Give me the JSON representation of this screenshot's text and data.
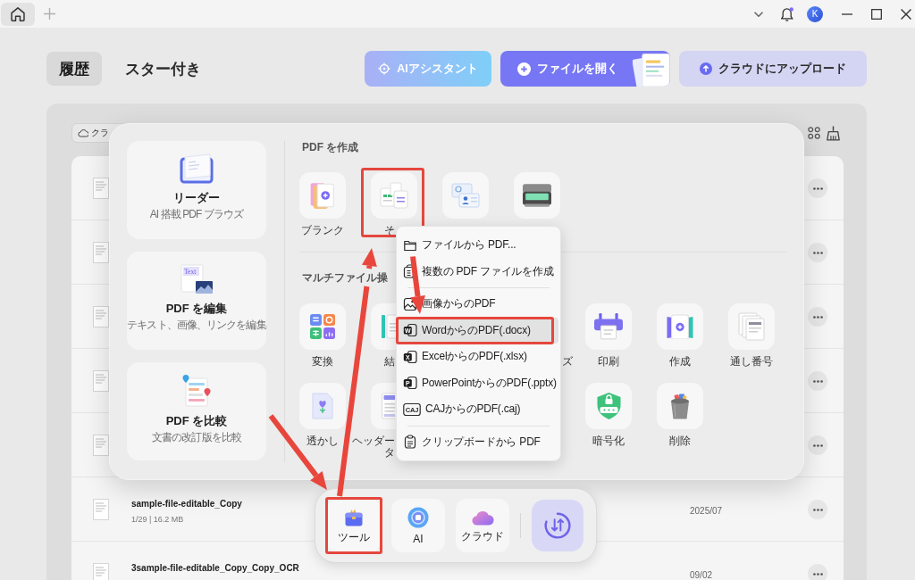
{
  "titlebar": {
    "avatar": "K"
  },
  "header": {
    "tabs": [
      {
        "label": "履歴",
        "selected": true
      },
      {
        "label": "スター付き",
        "selected": false
      }
    ],
    "actions": [
      {
        "kind": "ai",
        "label": "AIアシスタント"
      },
      {
        "kind": "open",
        "label": "ファイルを開く"
      },
      {
        "kind": "upload",
        "label": "クラウドにアップロード"
      }
    ]
  },
  "file_list": {
    "filter_button": "クラ",
    "rows": [
      {
        "kind": "covered"
      },
      {
        "kind": "covered"
      },
      {
        "kind": "covered"
      },
      {
        "kind": "covered"
      },
      {
        "kind": "covered"
      },
      {
        "kind": "file",
        "name": "sample-file-editable_Copy",
        "meta": "1/29 | 16.2 MB",
        "date": "2025/07"
      },
      {
        "kind": "file",
        "name": "3sample-file-editable_Copy_Copy_OCR",
        "date": "09/02"
      }
    ]
  },
  "tools_panel": {
    "features": [
      {
        "kind": "reader",
        "title": "リーダー",
        "subtitle": "AI 搭載 PDF ブラウズ"
      },
      {
        "kind": "edit",
        "title": "PDF を編集",
        "subtitle": "テキスト、画像、リンクを編集",
        "icon_text": "Text"
      },
      {
        "kind": "compare",
        "title": "PDF を比較",
        "subtitle": "文書の改訂版を比較"
      }
    ],
    "sections": [
      {
        "title": "PDF を作成",
        "rows": [
          [
            {
              "kind": "blank",
              "label": "ブランク",
              "annotated": false
            },
            {
              "kind": "other",
              "label": "そ",
              "annotated": true
            },
            {
              "kind": "id-card",
              "annotated": false
            },
            {
              "kind": "scanner",
              "annotated": false
            }
          ]
        ]
      },
      {
        "title": "マルチファイル操",
        "rows": [
          [
            {
              "kind": "convert",
              "label": "変換",
              "annotated": false
            },
            {
              "kind": "combine",
              "label": "結",
              "annotated": false
            },
            {
              "kind": "covered"
            },
            {
              "kind": "covered",
              "label": "ズ"
            },
            {
              "kind": "print",
              "label": "印刷",
              "annotated": false
            },
            {
              "kind": "create",
              "label": "作成",
              "annotated": false
            },
            {
              "kind": "number",
              "label": "通し番号",
              "annotated": false
            }
          ],
          [
            {
              "kind": "watermark",
              "label": "透かし",
              "annotated": false
            },
            {
              "kind": "header-footer",
              "label": "ヘッダータ",
              "annotated": false
            },
            {
              "kind": "covered"
            },
            {
              "kind": "covered"
            },
            {
              "kind": "encrypt",
              "label": "暗号化",
              "annotated": false
            },
            {
              "kind": "delete",
              "label": "削除",
              "annotated": false
            }
          ]
        ]
      }
    ]
  },
  "create_menu": {
    "groups": [
      {
        "items": [
          {
            "kind": "folder",
            "label": "ファイルから PDF...",
            "hovered": false,
            "annotated": false
          },
          {
            "kind": "stack",
            "label": "複数の PDF ファイルを作成",
            "hovered": false,
            "annotated": false
          }
        ]
      },
      {
        "items": [
          {
            "kind": "image",
            "label": "画像からのPDF",
            "hovered": false,
            "annotated": false
          },
          {
            "kind": "badge",
            "badge": "W",
            "label": "WordからのPDF(.docx)",
            "hovered": true,
            "annotated": true
          },
          {
            "kind": "badge",
            "badge": "X",
            "label": "ExcelからのPDF(.xlsx)",
            "hovered": false,
            "annotated": false
          },
          {
            "kind": "badge",
            "badge": "P",
            "label": "PowerPointからのPDF(.pptx)",
            "hovered": false,
            "annotated": false
          },
          {
            "kind": "boxed",
            "badge": "CAJ",
            "label": "CAJからのPDF(.caj)",
            "hovered": false,
            "annotated": false
          }
        ]
      },
      {
        "items": [
          {
            "kind": "clipboard",
            "label": "クリップボードから PDF",
            "hovered": false,
            "annotated": false
          }
        ]
      }
    ]
  },
  "dock": {
    "buttons": [
      {
        "kind": "tools",
        "label": "ツール",
        "annotated": true
      },
      {
        "kind": "ai",
        "label": "AI",
        "annotated": false
      },
      {
        "kind": "cloud",
        "label": "クラウド",
        "annotated": false
      },
      {
        "kind": "sync",
        "annotated": false
      }
    ]
  }
}
